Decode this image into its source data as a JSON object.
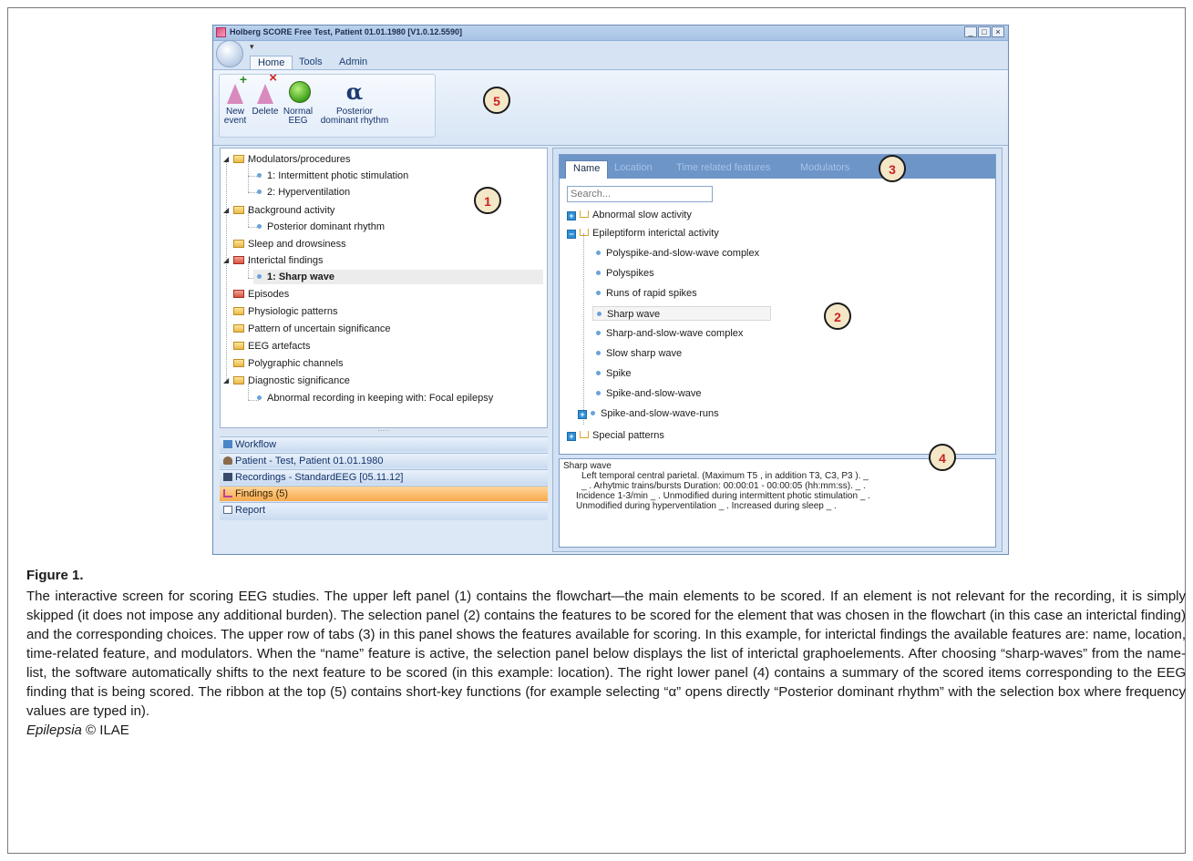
{
  "window": {
    "title": "Holberg SCORE Free Test, Patient 01.01.1980 [V1.0.12.5590]",
    "controls": [
      "_",
      "□",
      "×"
    ]
  },
  "qat_arrow": "▾",
  "ribbon": {
    "tabs": [
      "Home",
      "Tools",
      "Admin"
    ],
    "buttons": {
      "new_event": [
        "New",
        "event"
      ],
      "delete": "Delete",
      "normal_eeg": [
        "Normal",
        "EEG"
      ],
      "posterior_symbol": "α",
      "posterior": [
        "Posterior",
        "dominant rhythm"
      ]
    }
  },
  "callouts": {
    "c1": "1",
    "c2": "2",
    "c3": "3",
    "c4": "4",
    "c5": "5"
  },
  "flowchart": {
    "items": [
      "Modulators/procedures",
      "1: Intermittent photic stimulation",
      "2: Hyperventilation",
      "Background activity",
      "Posterior dominant rhythm",
      "Sleep and drowsiness",
      "Interictal findings",
      "1: Sharp wave",
      "Episodes",
      "Physiologic patterns",
      "Pattern of uncertain significance",
      "EEG artefacts",
      "Polygraphic channels",
      "Diagnostic significance",
      "Abnormal recording in keeping with: Focal epilepsy"
    ]
  },
  "splitter_grip": "·····",
  "navbars": [
    "Workflow",
    "Patient - Test, Patient 01.01.1980",
    "Recordings - StandardEEG [05.11.12]",
    "Findings (5)",
    "Report"
  ],
  "feature_tabs": [
    "Name",
    "Location",
    "Time related features",
    "Modulators"
  ],
  "search_placeholder": "Search...",
  "selection": {
    "abnormal_slow": "Abnormal slow activity",
    "epileptiform": "Epileptiform interictal activity",
    "elements": [
      "Polyspike-and-slow-wave complex",
      "Polyspikes",
      "Runs of rapid spikes",
      "Sharp wave",
      "Sharp-and-slow-wave complex",
      "Slow sharp wave",
      "Spike",
      "Spike-and-slow-wave",
      "Spike-and-slow-wave-runs"
    ],
    "special": "Special patterns"
  },
  "summary": {
    "lines": [
      "Sharp wave",
      "Left temporal central parietal. (Maximum T5 , in addition T3, C3, P3 ).  _",
      "_ .  Arhytmic trains/bursts Duration: 00:00:01 - 00:00:05 (hh:mm:ss). _ .",
      "Incidence 1-3/min _ .  Unmodified during intermittent photic stimulation _ .",
      "Unmodified during hyperventilation _ .  Increased during sleep _ ."
    ]
  },
  "caption": {
    "title": "Figure 1.",
    "body": "The interactive screen for scoring EEG studies. The upper left panel (1) contains the flowchart—the main elements to be scored. If an element is not relevant for the recording, it is simply skipped (it does not impose any additional burden). The selection panel (2) contains the features to be scored for the element that was chosen in the flowchart (in this case an interictal finding) and the corresponding choices. The upper row of tabs (3) in this panel shows the features available for scoring. In this example, for interictal findings the available features are: name, location, time-related feature, and modulators. When the “name” feature is active, the selection panel below displays the list of interictal graphoelements. After choosing “sharp-waves” from the name-list, the software automatically shifts to the next feature to be scored (in this example: location). The right lower panel (4) contains a summary of the scored items corresponding to the EEG finding that is being scored. The ribbon at the top (5) contains short-key functions (for example selecting “α” opens directly “Posterior dominant rhythm” with the selection box where frequency values are typed in).",
    "journal": "Epilepsia",
    "copyright": "©",
    "publisher": "ILAE"
  }
}
